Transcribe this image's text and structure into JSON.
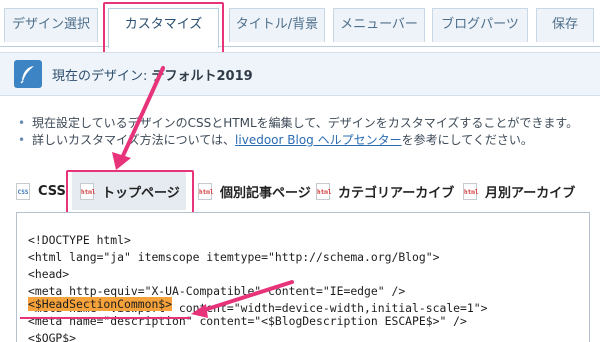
{
  "tabs": [
    {
      "label": "デザイン選択"
    },
    {
      "label": "カスタマイズ"
    },
    {
      "label": "タイトル/背景"
    },
    {
      "label": "メニューバー"
    },
    {
      "label": "ブログパーツ"
    },
    {
      "label": "保存"
    }
  ],
  "design": {
    "prefix": "現在のデザイン: ",
    "name": "デフォルト2019"
  },
  "info": {
    "line1": "現在設定しているデザインのCSSとHTMLを編集して、デザインをカスタマイズすることができます。",
    "line2_before": "詳しいカスタマイズ方法については、",
    "line2_link": "livedoor Blog ヘルプセンター",
    "line2_after": "を参考にしてください。"
  },
  "file_tabs": [
    {
      "label": "CSS",
      "icon": "css-file-icon",
      "icon_text": "CSS"
    },
    {
      "label": "トップページ",
      "icon": "html-file-icon",
      "icon_text": "html"
    },
    {
      "label": "個別記事ページ",
      "icon": "html-file-icon",
      "icon_text": "html"
    },
    {
      "label": "カテゴリアーカイブ",
      "icon": "html-file-icon",
      "icon_text": "html"
    },
    {
      "label": "月別アーカイブ",
      "icon": "html-file-icon",
      "icon_text": "html"
    }
  ],
  "code_lines": [
    "<!DOCTYPE html>",
    "<html lang=\"ja\" itemscope itemtype=\"http://schema.org/Blog\">",
    "<head>",
    "<meta http-equiv=\"X-UA-Compatible\" content=\"IE=edge\" />",
    "<meta name=\"viewport\" content=\"width=device-width,initial-scale=1\">",
    "<$HeadSectionCommon$>",
    "<meta name=\"description\" content=\"<$BlogDescription ESCAPE$>\" />",
    "<$OGP$>"
  ],
  "colors": {
    "accent": "#e7337a",
    "highlight": "#f6a23b",
    "link": "#2a6cb3"
  }
}
